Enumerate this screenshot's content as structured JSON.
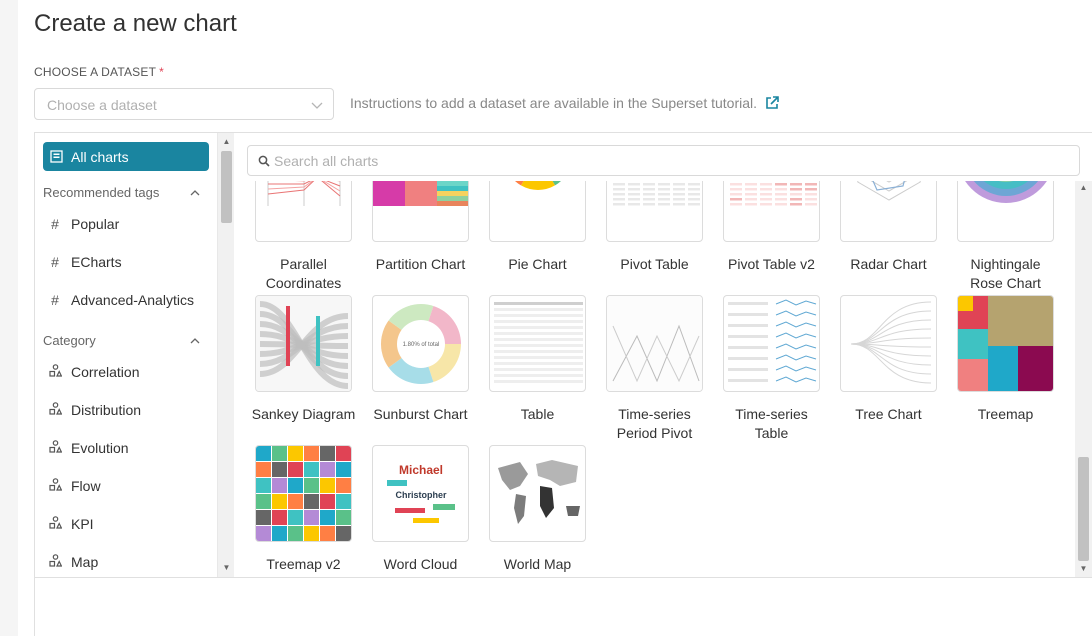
{
  "page": {
    "title": "Create a new chart"
  },
  "dataset": {
    "label": "CHOOSE A DATASET",
    "required_mark": "*",
    "placeholder": "Choose a dataset",
    "hint": "Instructions to add a dataset are available in the Superset tutorial."
  },
  "sidebar": {
    "all_charts": "All charts",
    "tags_header": "Recommended tags",
    "tags": [
      "Popular",
      "ECharts",
      "Advanced-Analytics"
    ],
    "category_header": "Category",
    "categories": [
      "Correlation",
      "Distribution",
      "Evolution",
      "Flow",
      "KPI",
      "Map"
    ]
  },
  "search": {
    "placeholder": "Search all charts"
  },
  "charts": [
    "Parallel Coordinates",
    "Partition Chart",
    "Pie Chart",
    "Pivot Table",
    "Pivot Table v2",
    "Radar Chart",
    "Nightingale Rose Chart",
    "Sankey Diagram",
    "Sunburst Chart",
    "Table",
    "Time-series Period Pivot",
    "Time-series Table",
    "Tree Chart",
    "Treemap",
    "Treemap v2",
    "Word Cloud",
    "World Map"
  ],
  "sunburst_thumb_text": "1.80% of total",
  "wordcloud_words": [
    "Michael",
    "Christopher"
  ],
  "colors": {
    "accent": "#1a85a0",
    "required": "#e04355"
  }
}
